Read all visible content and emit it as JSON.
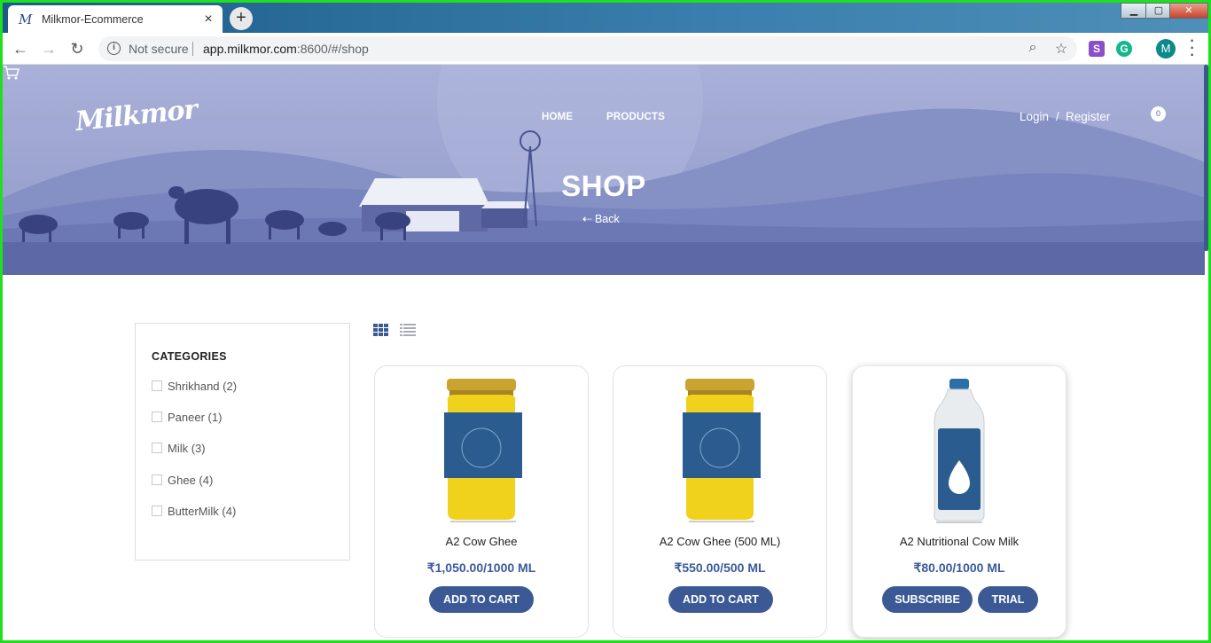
{
  "browser": {
    "tab_title": "Milkmor-Ecommerce",
    "tab_favicon": "M",
    "new_tab": "+",
    "security_label": "Not secure",
    "url_host": "app.milkmor.com",
    "url_rest": ":8600/#/shop",
    "profile_initial": "M",
    "ext1": "S",
    "ext2": "G"
  },
  "header": {
    "logo": "Milkmor",
    "nav": {
      "home": "HOME",
      "products": "PRODUCTS"
    },
    "login": "Login",
    "separator": "/",
    "register": "Register",
    "cart_count": "0",
    "title": "SHOP",
    "back_label": "Back"
  },
  "sidebar": {
    "title": "CATEGORIES",
    "items": [
      {
        "label": "Shrikhand (2)"
      },
      {
        "label": "Paneer (1)"
      },
      {
        "label": "Milk (3)"
      },
      {
        "label": "Ghee (4)"
      },
      {
        "label": "ButterMilk (4)"
      }
    ]
  },
  "products": [
    {
      "name": "A2 Cow Ghee",
      "price": "₹1,050.00/1000 ML",
      "button": "ADD TO CART"
    },
    {
      "name": "A2 Cow Ghee (500 ML)",
      "price": "₹550.00/500 ML",
      "button": "ADD TO CART"
    },
    {
      "name": "A2 Nutritional Cow Milk",
      "price": "₹80.00/1000 ML",
      "buttons": [
        "SUBSCRIBE",
        "TRIAL"
      ]
    }
  ],
  "colors": {
    "accent": "#3b5a95",
    "hero": "#9aa3cf",
    "frame": "#1ee01e"
  }
}
